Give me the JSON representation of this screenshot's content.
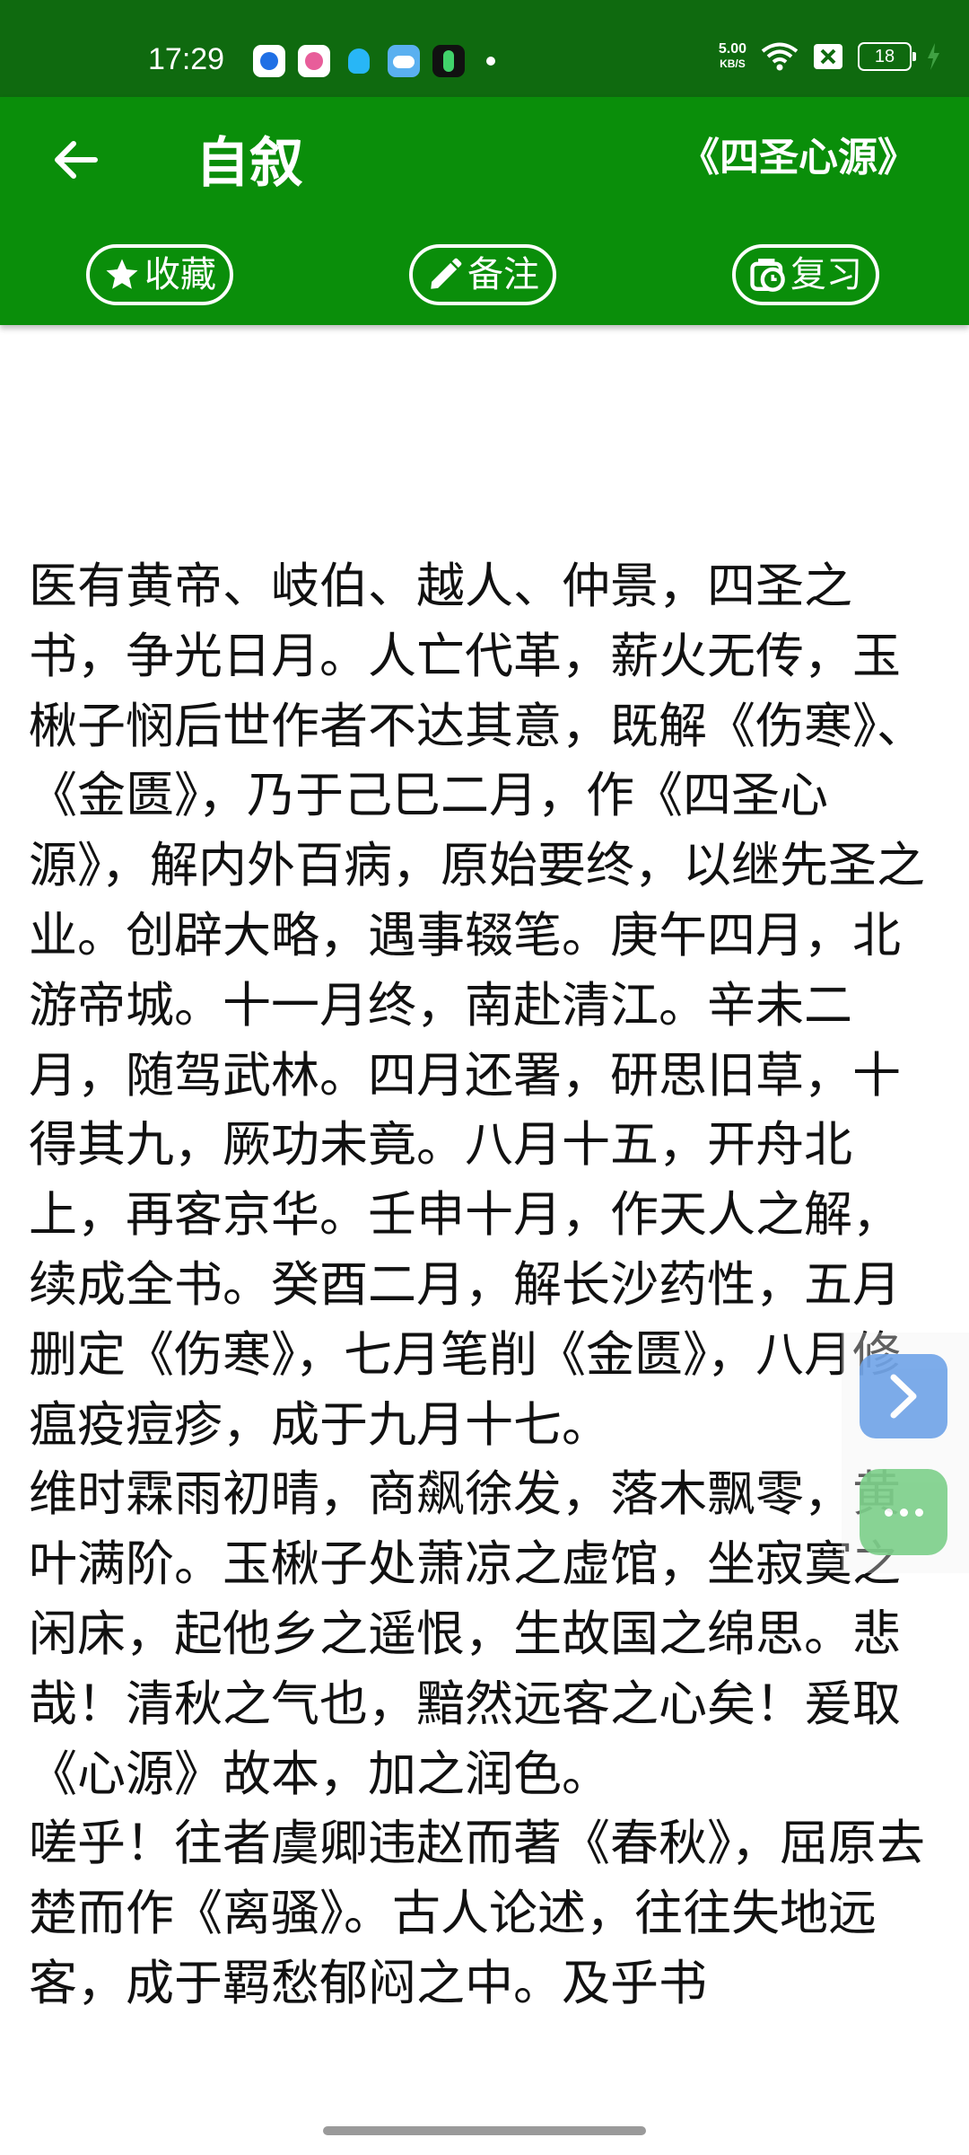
{
  "status_bar": {
    "time": "17:29",
    "net_speed_value": "5.00",
    "net_speed_unit": "KB/S",
    "battery": "18",
    "bg_color": "#0f6a0f"
  },
  "app_bar": {
    "title": "自叙",
    "book_title": "《四圣心源》",
    "back_icon": "arrow-left-icon",
    "bg_color": "#0a8e0a",
    "buttons": {
      "favorite": "收藏",
      "note": "备注",
      "review": "复习"
    }
  },
  "content": {
    "paragraphs": [
      "医有黄帝、岐伯、越人、仲景，四圣之书，争光日月。人亡代革，薪火无传，玉楸子悯后世作者不达其意，既解《伤寒》、《金匮》，乃于己巳二月，作《四圣心源》，解内外百病，原始要终，以继先圣之业。创辟大略，遇事辍笔。庚午四月，北游帝城。十一月终，南赴清江。辛未二月，随驾武林。四月还署，研思旧草，十得其九，厥功未竟。八月十五，开舟北上，再客京华。壬申十月，作天人之解，续成全书。癸酉二月，解长沙药性，五月删定《伤寒》，七月笔削《金匮》，八月修瘟疫痘疹，成于九月十七。",
      "维时霖雨初晴，商飙徐发，落木飘零，黄叶满阶。玉楸子处萧凉之虚馆，坐寂寞之闲床，起他乡之遥恨，生故国之绵思。悲哉！清秋之气也，黯然远客之心矣！爰取《心源》故本，加之润色。",
      "嗟乎！往者虞卿违赵而著《春秋》，屈原去楚而作《离骚》。古人论述，往往失地远客，成于羁愁郁闷之中。及乎书"
    ]
  },
  "floating": {
    "next_icon": "chevron-right-icon",
    "more_icon": "more-dots-icon"
  }
}
